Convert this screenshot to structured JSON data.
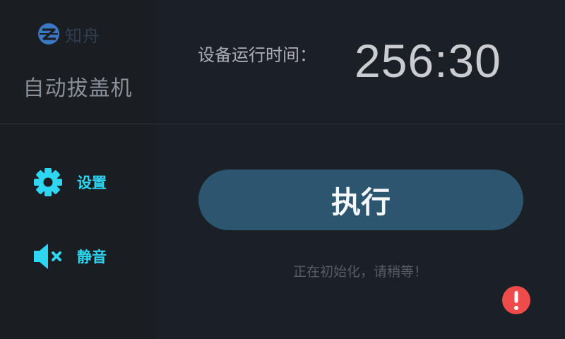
{
  "brand": {
    "logo_text": "知舟",
    "app_title": "自动拔盖机"
  },
  "nav": {
    "settings_label": "设置",
    "mute_label": "静音"
  },
  "runtime": {
    "label": "设备运行时间：",
    "value": "256:30"
  },
  "main": {
    "execute_label": "执行",
    "status_text": "正在初始化，请稍等！"
  },
  "icons": {
    "logo": "zhizhou-logo-icon",
    "settings": "gear-icon",
    "mute": "speaker-muted-icon",
    "alert": "exclamation-alert-icon"
  },
  "colors": {
    "background": "#1b2027",
    "sidebar": "#1a1d22",
    "accent": "#2ed6f2",
    "button": "#2c5670",
    "alert": "#ef4b4b"
  }
}
